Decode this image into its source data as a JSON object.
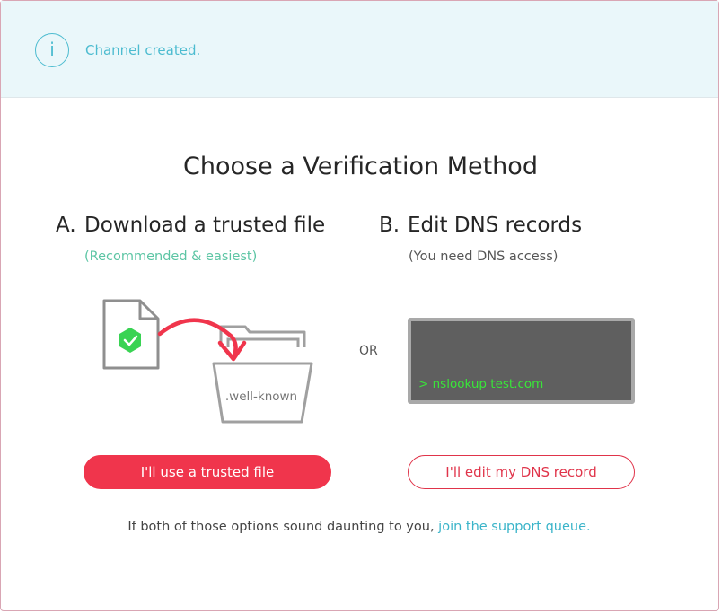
{
  "banner": {
    "icon": "info-icon",
    "icon_glyph": "i",
    "message": "Channel created."
  },
  "main": {
    "title": "Choose a Verification Method",
    "option_a": {
      "letter": "A.",
      "heading": "Download a trusted file",
      "subtitle": "(Recommended & easiest)",
      "folder_label": ".well-known",
      "button_label": "I'll use a trusted file"
    },
    "separator": "OR",
    "option_b": {
      "letter": "B.",
      "heading": "Edit DNS records",
      "subtitle": "(You need DNS access)",
      "terminal_text": "> nslookup test.com",
      "button_label": "I'll edit my DNS record"
    },
    "footer": {
      "text": "If both of those options sound daunting to you,",
      "link": "join the support queue."
    }
  },
  "colors": {
    "accent": "#f0354c",
    "info": "#4dbcd0",
    "recommended": "#5cc5a4",
    "terminal_bg": "#5f5f5f",
    "terminal_text": "#39e639"
  }
}
